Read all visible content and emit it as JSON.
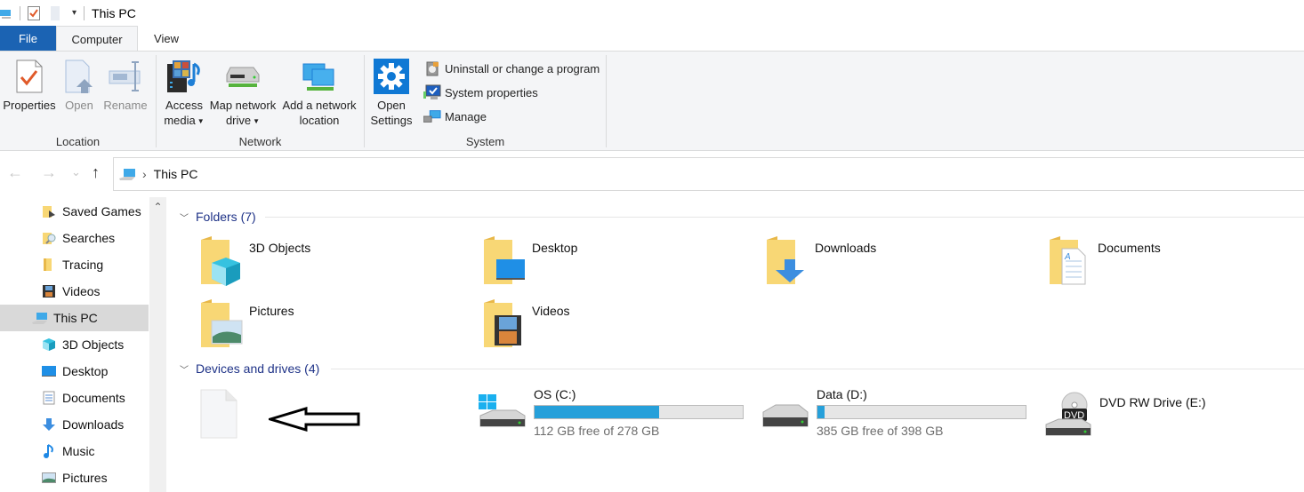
{
  "window": {
    "title": "This PC",
    "quick_access": [
      {
        "icon": "computer-icon"
      },
      {
        "icon": "properties-checkmark-icon"
      },
      {
        "icon": "new-folder-icon"
      },
      {
        "icon": "customize-dropdown-icon"
      }
    ]
  },
  "tabs": [
    {
      "label": "File",
      "active": false
    },
    {
      "label": "Computer",
      "active": true
    },
    {
      "label": "View",
      "active": false
    }
  ],
  "ribbon": {
    "groups": [
      {
        "label": "Location",
        "buttons": [
          {
            "label": "Properties",
            "icon": "properties-icon",
            "enabled": true
          },
          {
            "label": "Open",
            "icon": "open-icon",
            "enabled": false
          },
          {
            "label": "Rename",
            "icon": "rename-icon",
            "enabled": false
          }
        ]
      },
      {
        "label": "Network",
        "buttons": [
          {
            "label_line1": "Access",
            "label_line2": "media",
            "icon": "access-media-icon",
            "dropdown": true
          },
          {
            "label_line1": "Map network",
            "label_line2": "drive",
            "icon": "map-network-drive-icon",
            "dropdown": true
          },
          {
            "label_line1": "Add a network",
            "label_line2": "location",
            "icon": "add-network-location-icon",
            "dropdown": false
          }
        ]
      },
      {
        "label": "System",
        "big_button": {
          "label_line1": "Open",
          "label_line2": "Settings",
          "icon": "settings-gear-icon"
        },
        "small_buttons": [
          {
            "label": "Uninstall or change a program",
            "icon": "uninstall-program-icon"
          },
          {
            "label": "System properties",
            "icon": "system-properties-icon"
          },
          {
            "label": "Manage",
            "icon": "manage-computer-icon"
          }
        ]
      }
    ]
  },
  "navigation": {
    "back": "←",
    "forward": "→",
    "recent": "⌄",
    "up": "↑",
    "address_separator": "›",
    "address_path": "This PC"
  },
  "sidebar": {
    "items": [
      {
        "label": "Saved Games",
        "icon": "saved-games-folder-icon",
        "level": 2,
        "selected": false
      },
      {
        "label": "Searches",
        "icon": "searches-folder-icon",
        "level": 2,
        "selected": false
      },
      {
        "label": "Tracing",
        "icon": "folder-icon",
        "level": 2,
        "selected": false
      },
      {
        "label": "Videos",
        "icon": "videos-icon",
        "level": 2,
        "selected": false
      },
      {
        "label": "This PC",
        "icon": "this-pc-icon",
        "level": 1,
        "selected": true
      },
      {
        "label": "3D Objects",
        "icon": "3d-objects-icon",
        "level": 2,
        "selected": false
      },
      {
        "label": "Desktop",
        "icon": "desktop-icon",
        "level": 2,
        "selected": false
      },
      {
        "label": "Documents",
        "icon": "documents-icon",
        "level": 2,
        "selected": false
      },
      {
        "label": "Downloads",
        "icon": "downloads-icon",
        "level": 2,
        "selected": false
      },
      {
        "label": "Music",
        "icon": "music-icon",
        "level": 2,
        "selected": false
      },
      {
        "label": "Pictures",
        "icon": "pictures-icon",
        "level": 2,
        "selected": false
      }
    ],
    "scroll_up": "⌃"
  },
  "content": {
    "folders_section": {
      "title": "Folders (7)",
      "items": [
        {
          "name": "3D Objects",
          "icon": "3d-objects-folder-icon"
        },
        {
          "name": "Desktop",
          "icon": "desktop-folder-icon"
        },
        {
          "name": "Downloads",
          "icon": "downloads-folder-icon"
        },
        {
          "name": "Documents",
          "icon": "documents-folder-icon"
        },
        {
          "name": "Pictures",
          "icon": "pictures-folder-icon"
        },
        {
          "name": "Videos",
          "icon": "videos-folder-icon"
        }
      ]
    },
    "drives_section": {
      "title": "Devices and drives (4)",
      "items": [
        {
          "name": "",
          "icon": "blank-file-icon",
          "annotation": "left-arrow-annotation"
        },
        {
          "name": "OS (C:)",
          "icon": "windows-drive-icon",
          "free": "112 GB free of 278 GB",
          "used_fraction": 0.597
        },
        {
          "name": "Data (D:)",
          "icon": "hard-drive-icon",
          "free": "385 GB free of 398 GB",
          "used_fraction": 0.033
        },
        {
          "name": "DVD RW Drive (E:)",
          "icon": "dvd-drive-icon"
        }
      ]
    }
  },
  "colors": {
    "file_tab": "#1b63b3",
    "ribbon_bg": "#f4f5f7",
    "section_header": "#1e3287",
    "drive_bar": "#26a0da",
    "selection": "#d9d9d9",
    "folder_yellow": "#f8d775"
  }
}
